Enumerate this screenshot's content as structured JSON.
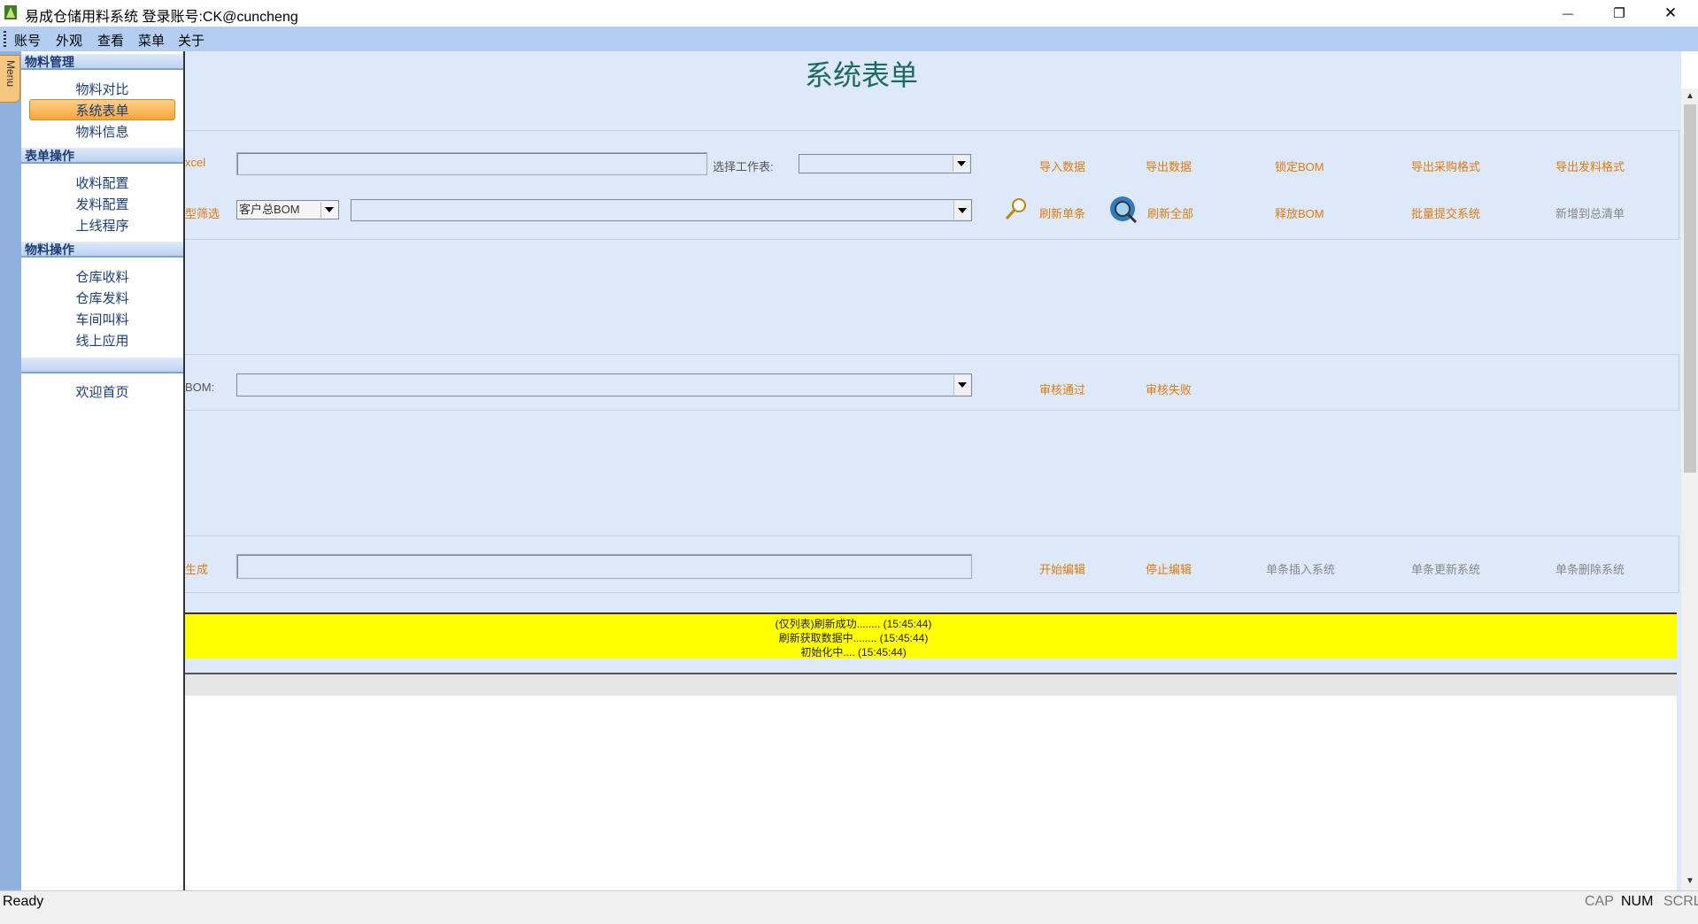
{
  "window": {
    "title": "易成仓储用料系统 登录账号:CK@cuncheng",
    "minimize": "—",
    "restore": "❐",
    "close": "✕"
  },
  "menubar": [
    "账号",
    "外观",
    "查看",
    "菜单",
    "关于"
  ],
  "menu_tab": "Menu",
  "nav": {
    "groups": [
      {
        "header": "物料管理",
        "items": [
          "物料对比",
          "系统表单",
          "物料信息"
        ]
      },
      {
        "header": "表单操作",
        "items": [
          "收料配置",
          "发料配置",
          "上线程序"
        ]
      },
      {
        "header": "物料操作",
        "items": [
          "仓库收料",
          "仓库发料",
          "车间叫料",
          "线上应用"
        ]
      },
      {
        "header": "",
        "items": [
          "欢迎首页"
        ]
      }
    ],
    "selected": "系统表单"
  },
  "page_title": "系统表单",
  "section1": {
    "row1_label": "xcel",
    "excel_path": "",
    "worksheet_label": "选择工作表:",
    "worksheet_value": "",
    "actions": [
      "导入数据",
      "导出数据",
      "锁定BOM",
      "导出采购格式",
      "导出发料格式"
    ],
    "row2_label": "型筛选",
    "bom_type": "客户总BOM",
    "bom_select": "",
    "actions2": [
      "刷新单条",
      "刷新全部",
      "释放BOM",
      "批量提交系统",
      "新增到总清单"
    ]
  },
  "section2": {
    "label": "BOM:",
    "value": "",
    "actions": [
      "审核通过",
      "审核失败"
    ]
  },
  "section3": {
    "label": "生成",
    "value": "",
    "actions": [
      "开始编辑",
      "停止编辑",
      "单条插入系统",
      "单条更新系统",
      "单条删除系统"
    ]
  },
  "log": [
    "(仅列表)刷新成功........ (15:45:44)",
    "刷新获取数据中........ (15:45:44)",
    "初始化中.... (15:45:44)"
  ],
  "statusbar": {
    "ready": "Ready",
    "cap": "CAP",
    "num": "NUM",
    "scrl": "SCRL"
  },
  "colors": {
    "menubar": "#b4cef2",
    "accent_orange": "#e07b10",
    "log_bg": "#ffff00"
  }
}
